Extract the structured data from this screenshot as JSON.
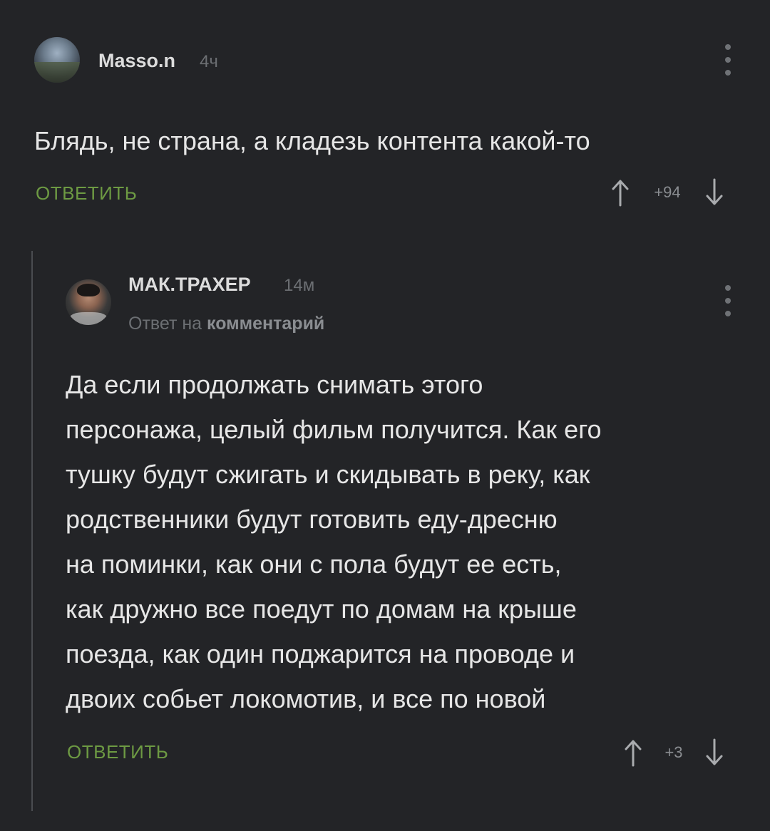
{
  "comments": [
    {
      "username": "Masso.n",
      "time": "4ч",
      "text": "Блядь, не страна, а кладезь контента какой-то",
      "reply_label": "ОТВЕТИТЬ",
      "rating": "+94"
    },
    {
      "username": "МАК.ТРАХЕР",
      "time": "14м",
      "reply_to_prefix": "Ответ на",
      "reply_to_link": "комментарий",
      "text_lines": [
        "Да если продолжать снимать этого",
        "персонажа, целый фильм получится. Как его",
        "тушку будут сжигать и скидывать в реку, как",
        "родственники будут готовить еду-дресню",
        "на поминки, как они с пола будут ее есть,",
        "как дружно все поедут по домам на крыше",
        "поезда, как один поджарится на проводе и",
        "двоих собьет локомотив, и все по новой"
      ],
      "reply_label": "ОТВЕТИТЬ",
      "rating": "+3"
    }
  ],
  "icons": {
    "menu": "more-vertical-icon",
    "upvote": "arrow-up-icon",
    "downvote": "arrow-down-icon"
  },
  "colors": {
    "background": "#232427",
    "accent_green": "#6d9a43",
    "muted": "#6c6f73"
  }
}
